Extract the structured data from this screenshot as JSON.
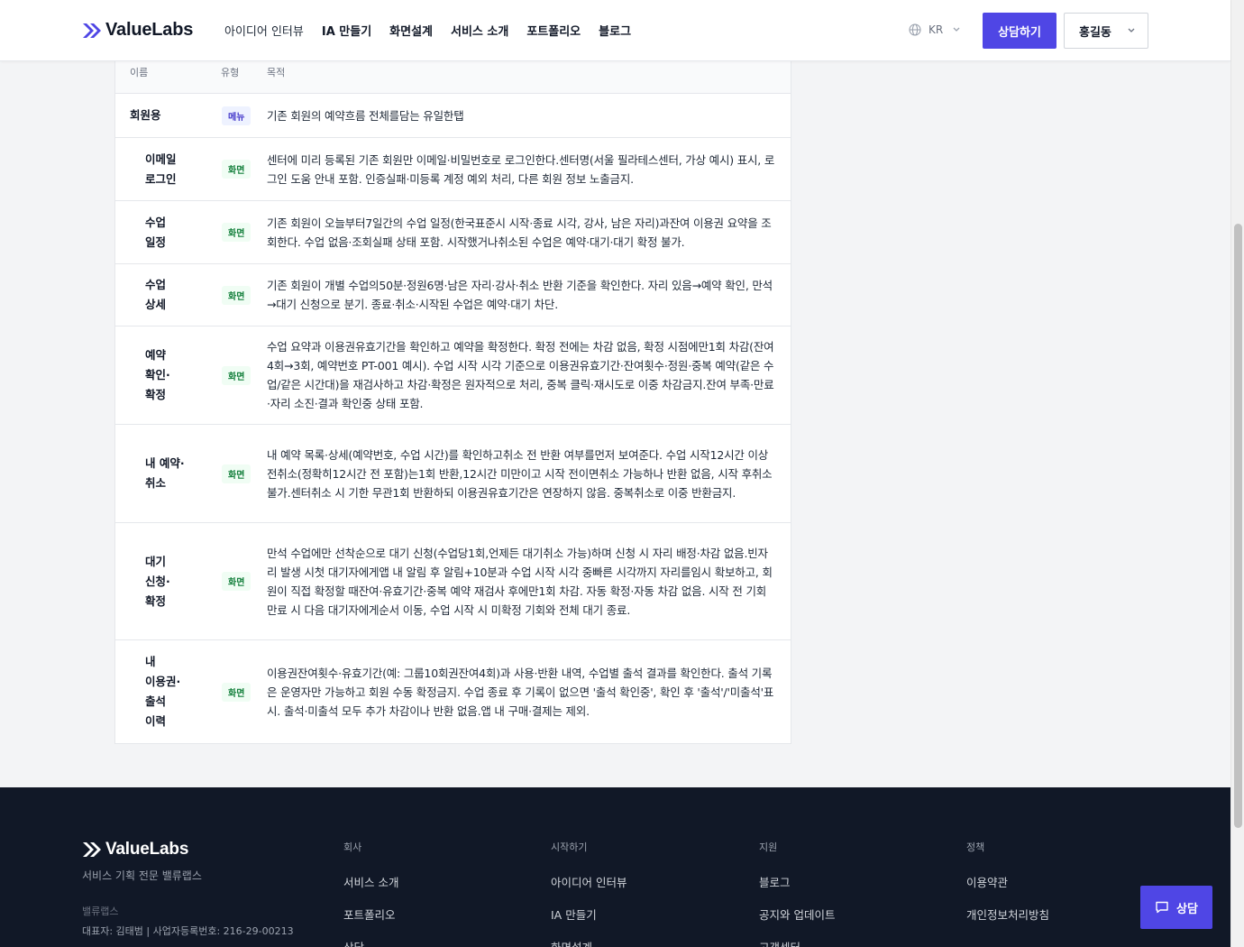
{
  "header": {
    "logo_text": "ValueLabs",
    "nav": [
      {
        "label": "아이디어 인터뷰"
      },
      {
        "label": "IA 만들기"
      },
      {
        "label": "화면설계"
      },
      {
        "label": "서비스 소개"
      },
      {
        "label": "포트폴리오"
      },
      {
        "label": "블로그"
      }
    ],
    "lang": "KR",
    "cta_label": "상담하기",
    "user_name": "홍길동"
  },
  "table": {
    "headers": {
      "name": "이름",
      "type": "유형",
      "purpose": "목적"
    },
    "rows": [
      {
        "name": "회원용",
        "type": "메뉴",
        "desc": "기존 회원의 예약흐름 전체를담는 유일한탭"
      },
      {
        "name": "이메일\n로그인",
        "type": "화면",
        "desc": "센터에 미리 등록된 기존 회원만 이메일·비밀번호로 로그인한다.센터명(서울 필라테스센터, 가상 예시) 표시, 로그인 도움 안내 포함. 인증실패·미등록 계정 예외 처리, 다른 회원 정보 노출금지."
      },
      {
        "name": "수업\n일정",
        "type": "화면",
        "desc": "기존 회원이 오늘부터7일간의 수업 일정(한국표준시 시작·종료 시각, 강사, 남은 자리)과잔여 이용권 요약을 조회한다. 수업 없음·조회실패 상태 포함. 시작했거나취소된 수업은 예약·대기·대기 확정 불가."
      },
      {
        "name": "수업\n상세",
        "type": "화면",
        "desc": "기존 회원이 개별 수업의50분·정원6명·남은 자리·강사·취소 반환 기준을 확인한다. 자리 있음→예약 확인, 만석→대기 신청으로 분기. 종료·취소·시작된 수업은 예약·대기 차단."
      },
      {
        "name": "예약\n확인·\n확정",
        "type": "화면",
        "desc": "수업 요약과 이용권유효기간을 확인하고 예약을 확정한다. 확정 전에는 차감 없음, 확정 시점에만1회 차감(잔여4회→3회, 예약번호 PT-001 예시). 수업 시작 시각 기준으로 이용권유효기간·잔여횟수·정원·중복 예약(같은 수업/같은 시간대)을 재검사하고 차감·확정은 원자적으로 처리, 중복 클릭·재시도로 이중 차감금지.잔여 부족·만료·자리 소진·결과 확인중 상태 포함."
      },
      {
        "name": "내 예약·\n취소",
        "type": "화면",
        "desc": "내 예약 목록·상세(예약번호, 수업 시간)를 확인하고취소 전 반환 여부를먼저 보여준다. 수업 시작12시간 이상 전취소(정확히12시간 전 포함)는1회 반환,12시간 미만이고 시작 전이면취소 가능하나 반환 없음, 시작 후취소 불가.센터취소 시 기한 무관1회 반환하되 이용권유효기간은 연장하지 않음. 중복취소로 이중 반환금지."
      },
      {
        "name": "대기\n신청·\n확정",
        "type": "화면",
        "desc": "만석 수업에만 선착순으로 대기 신청(수업당1회,언제든 대기취소 가능)하며 신청 시 자리 배정·차감 없음.빈자리 발생 시첫 대기자에게앱 내 알림 후 알림+10분과 수업 시작 시각 중빠른 시각까지 자리를임시 확보하고, 회원이 직접 확정할 때잔여·유효기간·중복 예약 재검사 후에만1회 차감. 자동 확정·자동 차감 없음. 시작 전 기회 만료 시 다음 대기자에게순서 이동, 수업 시작 시 미확정 기회와 전체 대기 종료."
      },
      {
        "name": "내\n이용권·\n출석\n이력",
        "type": "화면",
        "desc": "이용권잔여횟수·유효기간(예: 그룹10회권잔여4회)과 사용·반환 내역, 수업별 출석 결과를 확인한다. 출석 기록은 운영자만 가능하고 회원 수동 확정금지. 수업 종료 후 기록이 없으면 '출석 확인중', 확인 후 '출석'/'미출석'표시. 출석·미출석 모두 추가 차감이나 반환 없음.앱 내 구매·결제는 제외."
      }
    ]
  },
  "footer": {
    "logo_text": "ValueLabs",
    "tagline": "서비스 기획 전문 밸류랩스",
    "company": "밸류랩스",
    "info": "대표자: 김태범 | 사업자등록번호: 216-29-00213",
    "columns": [
      {
        "title": "회사",
        "links": [
          "서비스 소개",
          "포트폴리오",
          "상담"
        ]
      },
      {
        "title": "시작하기",
        "links": [
          "아이디어 인터뷰",
          "IA 만들기",
          "화면설계"
        ]
      },
      {
        "title": "지원",
        "links": [
          "블로그",
          "공지와 업데이트",
          "고객센터"
        ]
      },
      {
        "title": "정책",
        "links": [
          "이용약관",
          "개인정보처리방침"
        ]
      }
    ]
  },
  "chat_label": "상담",
  "colors": {
    "accent": "#4f46e5",
    "footer_bg": "#111827",
    "menu_badge": "#4338ca",
    "screen_badge": "#15803d"
  }
}
